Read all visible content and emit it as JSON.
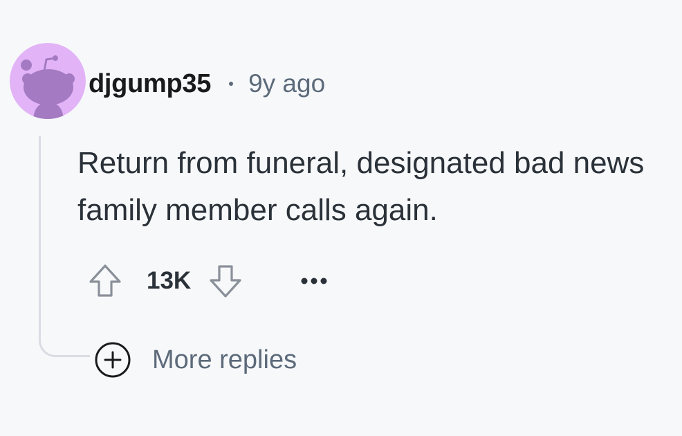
{
  "comment": {
    "username": "djgump35",
    "time_ago": "9y ago",
    "body": "Return from funeral, designated bad news family member calls again.",
    "score": "13K",
    "more_replies_label": "More replies",
    "avatar_icon": "reddit-snoo-avatar",
    "colors": {
      "avatar_background": "#e2b3f7",
      "avatar_figure": "#a47bc2",
      "muted_text": "#5c6a7a",
      "thread_line": "#d9dde3"
    }
  }
}
